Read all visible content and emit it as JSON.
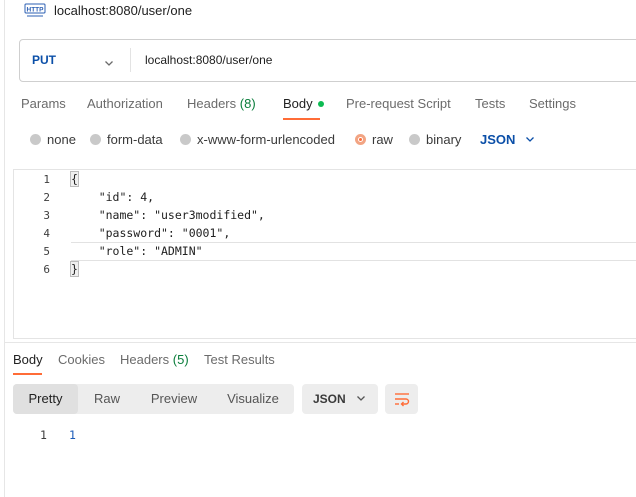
{
  "window": {
    "title": "localhost:8080/user/one",
    "icon": "http-icon"
  },
  "request": {
    "method": "PUT",
    "url": "localhost:8080/user/one"
  },
  "request_tabs": [
    {
      "label": "Params"
    },
    {
      "label": "Authorization"
    },
    {
      "label": "Headers",
      "count": "(8)"
    },
    {
      "label": "Body",
      "active": true,
      "indicator": "green-dot"
    },
    {
      "label": "Pre-request Script"
    },
    {
      "label": "Tests"
    },
    {
      "label": "Settings"
    }
  ],
  "body_types": [
    {
      "label": "none",
      "selected": false
    },
    {
      "label": "form-data",
      "selected": false
    },
    {
      "label": "x-www-form-urlencoded",
      "selected": false
    },
    {
      "label": "raw",
      "selected": true
    },
    {
      "label": "binary",
      "selected": false
    }
  ],
  "body_format": "JSON",
  "editor": {
    "line_numbers": [
      "1",
      "2",
      "3",
      "4",
      "5",
      "6"
    ],
    "lines": [
      "{",
      "    \"id\": 4,",
      "    \"name\": \"user3modified\",",
      "    \"password\": \"0001\",",
      "    \"role\": \"ADMIN\"",
      "}"
    ]
  },
  "response_tabs": [
    {
      "label": "Body",
      "active": true
    },
    {
      "label": "Cookies"
    },
    {
      "label": "Headers",
      "count": "(5)"
    },
    {
      "label": "Test Results"
    }
  ],
  "response_views": [
    {
      "label": "Pretty",
      "active": true
    },
    {
      "label": "Raw"
    },
    {
      "label": "Preview"
    },
    {
      "label": "Visualize"
    }
  ],
  "response_format": "JSON",
  "response_body": {
    "line_number": "1",
    "value": "1"
  },
  "colors": {
    "accent": "#ff6c37",
    "method": "#0b4fa8",
    "count": "#0a7d3b",
    "active_dot": "#0cbb52"
  }
}
